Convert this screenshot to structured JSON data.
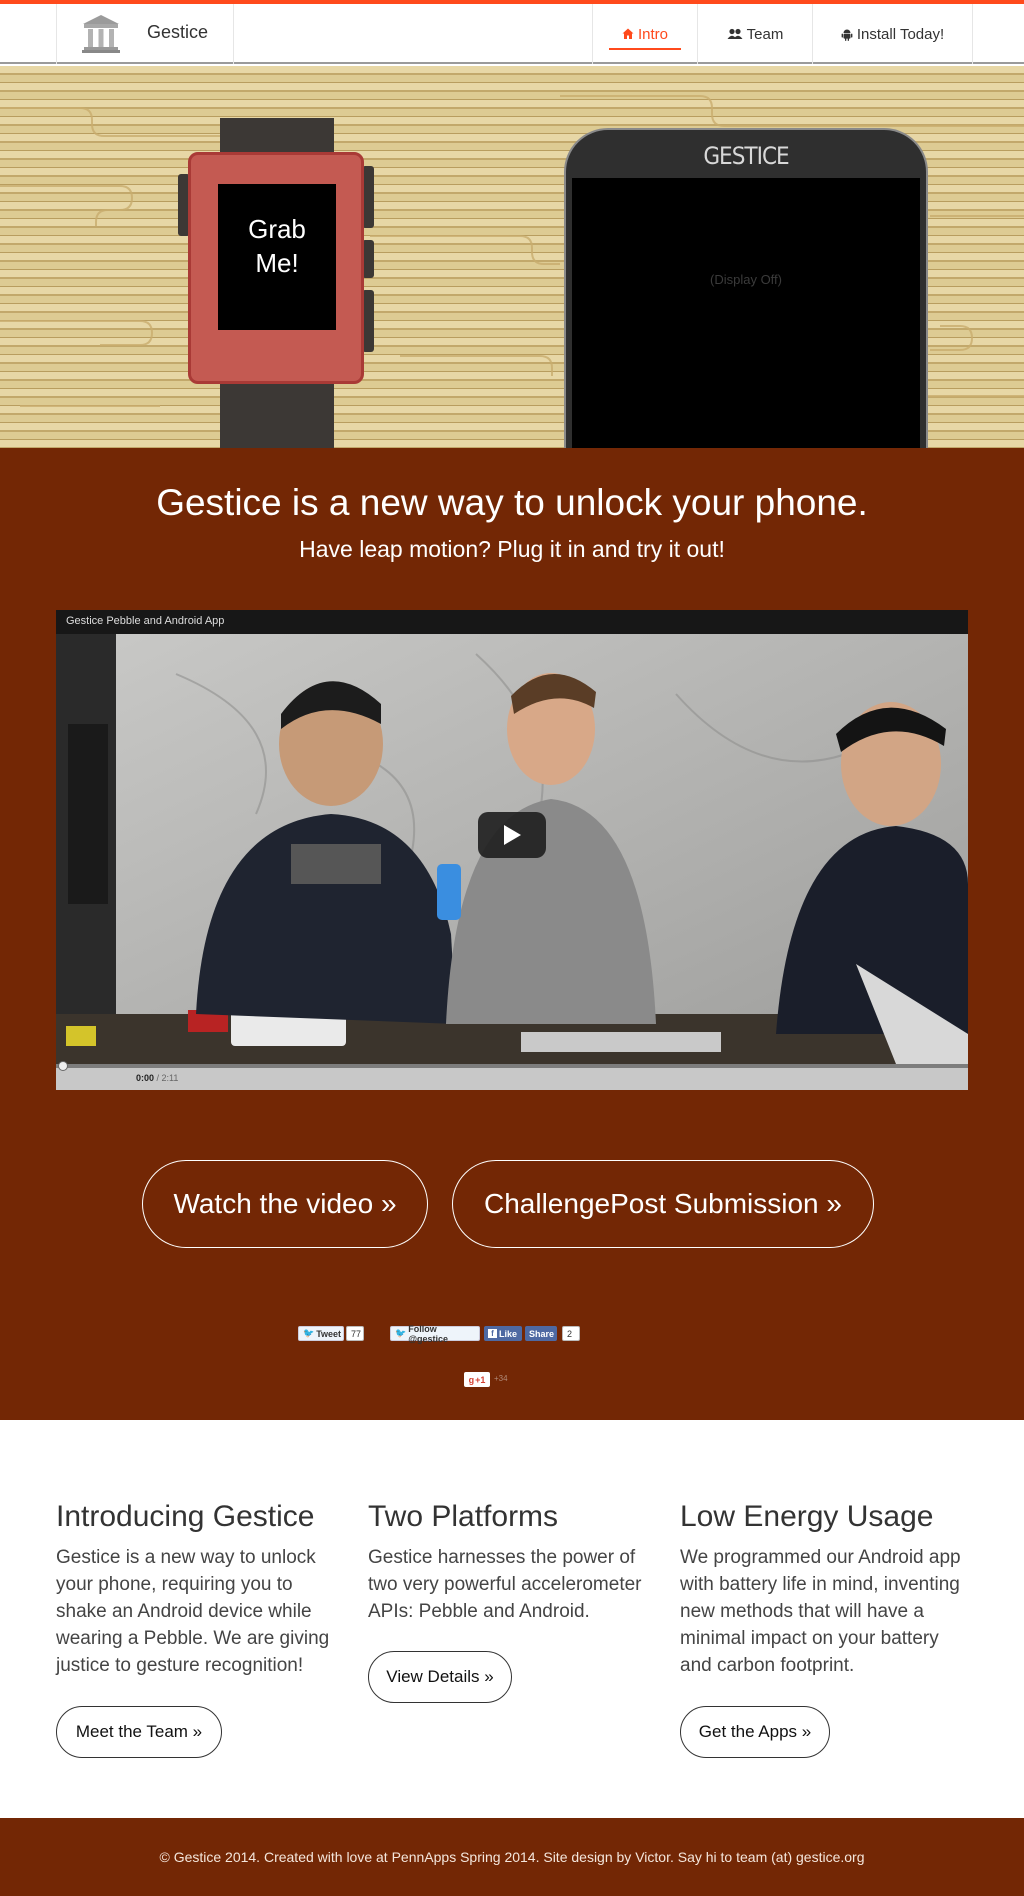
{
  "brand": {
    "name": "Gestice"
  },
  "nav": {
    "items": [
      {
        "label": "Intro",
        "icon": "home-icon",
        "active": true
      },
      {
        "label": "Team",
        "icon": "users-icon",
        "active": false
      },
      {
        "label": "Install Today!",
        "icon": "android-icon",
        "active": false
      }
    ]
  },
  "hero": {
    "watch_text_line1": "Grab",
    "watch_text_line2": "Me!",
    "phone_brand": "GESTICE",
    "phone_status": "(Display Off)"
  },
  "jumbotron": {
    "headline": "Gestice is a new way to unlock your phone.",
    "subline": "Have leap motion? Plug it in and try it out!",
    "video": {
      "title": "Gestice Pebble and Android App",
      "time_current": "0:00",
      "time_total": "/ 2:11"
    },
    "buttons": {
      "watch": "Watch the video »",
      "challenge": "ChallengePost Submission »"
    },
    "social": {
      "tweet": "Tweet",
      "tweet_count": "77",
      "follow": "Follow @gestice",
      "like": "Like",
      "share": "Share",
      "share_count": "2",
      "gplus": "+1",
      "gplus_count": "+34"
    }
  },
  "features": [
    {
      "title": "Introducing Gestice",
      "body": "Gestice is a new way to unlock your phone, requiring you to shake an Android device while wearing a Pebble. We are giving justice to gesture recognition!",
      "button": "Meet the Team »"
    },
    {
      "title": "Two Platforms",
      "body": "Gestice harnesses the power of two very powerful accelerometer APIs: Pebble and Android.",
      "button": "View Details »"
    },
    {
      "title": "Low Energy Usage",
      "body": "We programmed our Android app with battery life in mind, inventing new methods that will have a minimal impact on your battery and carbon footprint.",
      "button": "Get the Apps »"
    }
  ],
  "footer": {
    "text": "© Gestice 2014. Created with love at PennApps Spring 2014. Site design by Victor. Say hi to team (at) gestice.org"
  },
  "colors": {
    "accent": "#ff4a1c",
    "brown": "#732705",
    "watch_red": "#c45a52"
  }
}
